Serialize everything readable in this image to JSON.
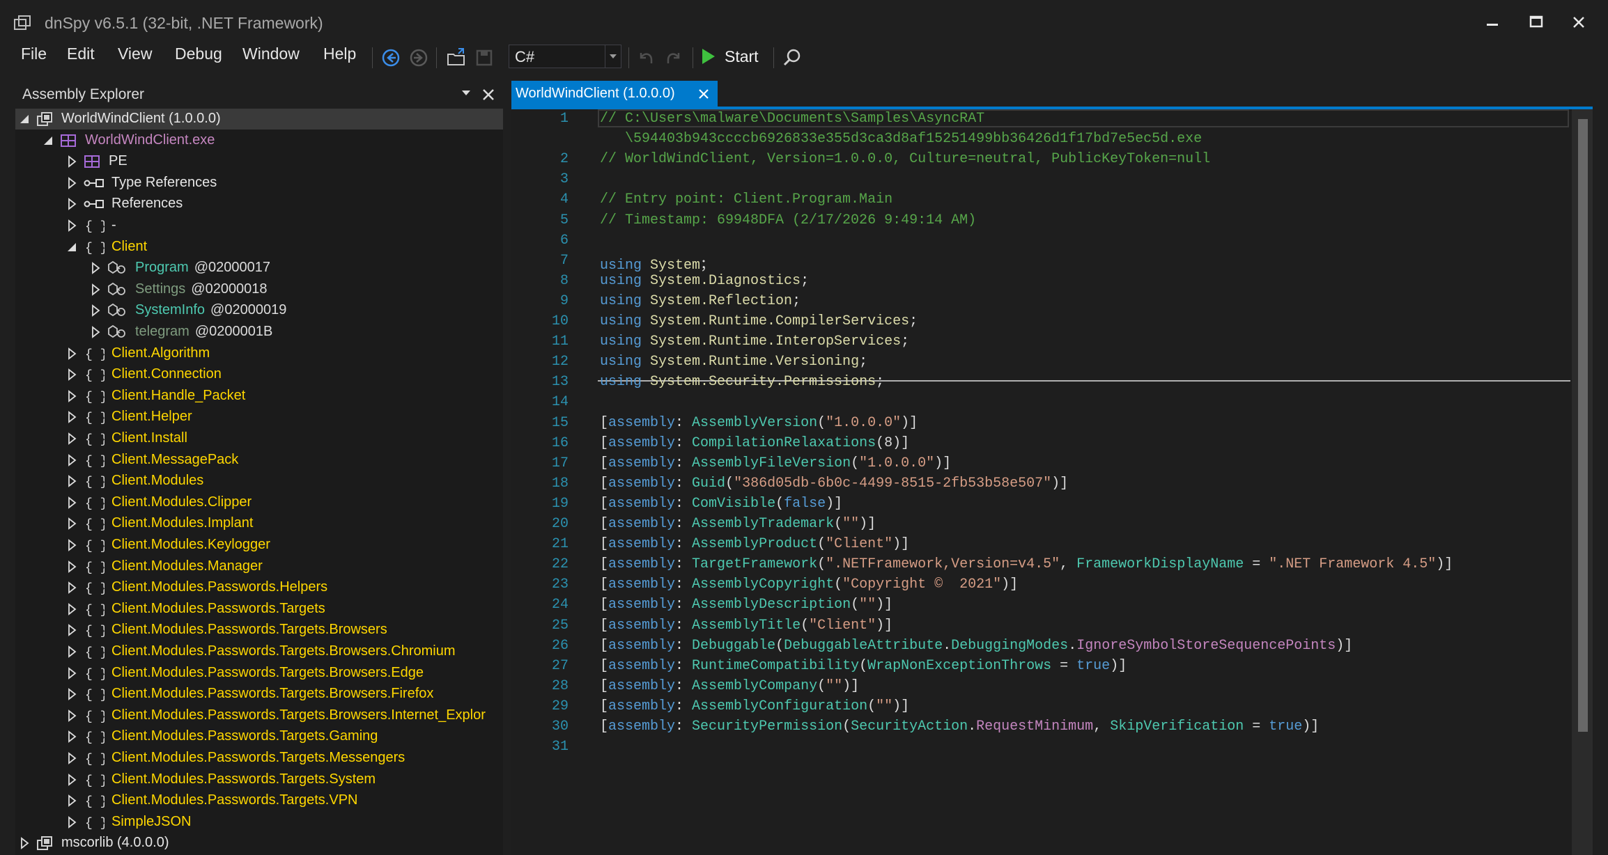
{
  "window": {
    "title": "dnSpy v6.5.1 (32-bit, .NET Framework)",
    "icons": [
      "app-icon",
      "minimize-icon",
      "maximize-icon",
      "close-icon"
    ]
  },
  "menu": [
    "File",
    "Edit",
    "View",
    "Debug",
    "Window",
    "Help"
  ],
  "toolbar": {
    "language": "C#",
    "start_label": "Start",
    "icons": [
      "back-icon",
      "forward-icon",
      "open-folder-icon",
      "save-icon",
      "undo-icon",
      "redo-icon",
      "start-icon",
      "search-icon"
    ]
  },
  "explorer": {
    "title": "Assembly Explorer",
    "items": [
      {
        "label": "WorldWindClient (1.0.0.0)",
        "suffix": "",
        "level": 0,
        "state": "expanded",
        "icon": "assembly-icon",
        "color": "#e6e6e6",
        "selected": true
      },
      {
        "label": "WorldWindClient.exe",
        "suffix": "",
        "level": 1,
        "state": "expanded",
        "icon": "module-icon",
        "color": "#c586c0"
      },
      {
        "label": "PE",
        "suffix": "",
        "level": 2,
        "state": "collapsed",
        "icon": "module-icon",
        "color": "#e6e6e6"
      },
      {
        "label": "Type References",
        "suffix": "",
        "level": 2,
        "state": "collapsed",
        "icon": "references-icon",
        "color": "#e6e6e6"
      },
      {
        "label": "References",
        "suffix": "",
        "level": 2,
        "state": "collapsed",
        "icon": "references-icon",
        "color": "#e6e6e6"
      },
      {
        "label": "-",
        "suffix": "",
        "level": 2,
        "state": "collapsed",
        "icon": "namespace-icon",
        "color": "#e6e6e6"
      },
      {
        "label": "Client",
        "suffix": "",
        "level": 2,
        "state": "expanded",
        "icon": "namespace-icon",
        "color": "#ffd700"
      },
      {
        "label": "Program",
        "suffix": "@02000017",
        "level": 3,
        "state": "collapsed",
        "icon": "class-icon",
        "color": "#4ec9b0"
      },
      {
        "label": "Settings",
        "suffix": "@02000018",
        "level": 3,
        "state": "collapsed",
        "icon": "class-icon",
        "color": "#7f9c7f"
      },
      {
        "label": "SystemInfo",
        "suffix": "@02000019",
        "level": 3,
        "state": "collapsed",
        "icon": "class-icon",
        "color": "#4ec9b0"
      },
      {
        "label": "telegram",
        "suffix": "@0200001B",
        "level": 3,
        "state": "collapsed",
        "icon": "class-icon",
        "color": "#7f9c7f"
      },
      {
        "label": "Client.Algorithm",
        "suffix": "",
        "level": 2,
        "state": "collapsed",
        "icon": "namespace-icon",
        "color": "#ffd700"
      },
      {
        "label": "Client.Connection",
        "suffix": "",
        "level": 2,
        "state": "collapsed",
        "icon": "namespace-icon",
        "color": "#ffd700"
      },
      {
        "label": "Client.Handle_Packet",
        "suffix": "",
        "level": 2,
        "state": "collapsed",
        "icon": "namespace-icon",
        "color": "#ffd700"
      },
      {
        "label": "Client.Helper",
        "suffix": "",
        "level": 2,
        "state": "collapsed",
        "icon": "namespace-icon",
        "color": "#ffd700"
      },
      {
        "label": "Client.Install",
        "suffix": "",
        "level": 2,
        "state": "collapsed",
        "icon": "namespace-icon",
        "color": "#ffd700"
      },
      {
        "label": "Client.MessagePack",
        "suffix": "",
        "level": 2,
        "state": "collapsed",
        "icon": "namespace-icon",
        "color": "#ffd700"
      },
      {
        "label": "Client.Modules",
        "suffix": "",
        "level": 2,
        "state": "collapsed",
        "icon": "namespace-icon",
        "color": "#ffd700"
      },
      {
        "label": "Client.Modules.Clipper",
        "suffix": "",
        "level": 2,
        "state": "collapsed",
        "icon": "namespace-icon",
        "color": "#ffd700"
      },
      {
        "label": "Client.Modules.Implant",
        "suffix": "",
        "level": 2,
        "state": "collapsed",
        "icon": "namespace-icon",
        "color": "#ffd700"
      },
      {
        "label": "Client.Modules.Keylogger",
        "suffix": "",
        "level": 2,
        "state": "collapsed",
        "icon": "namespace-icon",
        "color": "#ffd700"
      },
      {
        "label": "Client.Modules.Manager",
        "suffix": "",
        "level": 2,
        "state": "collapsed",
        "icon": "namespace-icon",
        "color": "#ffd700"
      },
      {
        "label": "Client.Modules.Passwords.Helpers",
        "suffix": "",
        "level": 2,
        "state": "collapsed",
        "icon": "namespace-icon",
        "color": "#ffd700"
      },
      {
        "label": "Client.Modules.Passwords.Targets",
        "suffix": "",
        "level": 2,
        "state": "collapsed",
        "icon": "namespace-icon",
        "color": "#ffd700"
      },
      {
        "label": "Client.Modules.Passwords.Targets.Browsers",
        "suffix": "",
        "level": 2,
        "state": "collapsed",
        "icon": "namespace-icon",
        "color": "#ffd700"
      },
      {
        "label": "Client.Modules.Passwords.Targets.Browsers.Chromium",
        "suffix": "",
        "level": 2,
        "state": "collapsed",
        "icon": "namespace-icon",
        "color": "#ffd700"
      },
      {
        "label": "Client.Modules.Passwords.Targets.Browsers.Edge",
        "suffix": "",
        "level": 2,
        "state": "collapsed",
        "icon": "namespace-icon",
        "color": "#ffd700"
      },
      {
        "label": "Client.Modules.Passwords.Targets.Browsers.Firefox",
        "suffix": "",
        "level": 2,
        "state": "collapsed",
        "icon": "namespace-icon",
        "color": "#ffd700"
      },
      {
        "label": "Client.Modules.Passwords.Targets.Browsers.Internet_Explor",
        "suffix": "",
        "level": 2,
        "state": "collapsed",
        "icon": "namespace-icon",
        "color": "#ffd700"
      },
      {
        "label": "Client.Modules.Passwords.Targets.Gaming",
        "suffix": "",
        "level": 2,
        "state": "collapsed",
        "icon": "namespace-icon",
        "color": "#ffd700"
      },
      {
        "label": "Client.Modules.Passwords.Targets.Messengers",
        "suffix": "",
        "level": 2,
        "state": "collapsed",
        "icon": "namespace-icon",
        "color": "#ffd700"
      },
      {
        "label": "Client.Modules.Passwords.Targets.System",
        "suffix": "",
        "level": 2,
        "state": "collapsed",
        "icon": "namespace-icon",
        "color": "#ffd700"
      },
      {
        "label": "Client.Modules.Passwords.Targets.VPN",
        "suffix": "",
        "level": 2,
        "state": "collapsed",
        "icon": "namespace-icon",
        "color": "#ffd700"
      },
      {
        "label": "SimpleJSON",
        "suffix": "",
        "level": 2,
        "state": "collapsed",
        "icon": "namespace-icon",
        "color": "#ffd700"
      },
      {
        "label": "mscorlib (4.0.0.0)",
        "suffix": "",
        "level": 0,
        "state": "collapsed",
        "icon": "assembly-icon",
        "color": "#e6e6e6"
      }
    ]
  },
  "tab": {
    "label": "WorldWindClient (1.0.0.0)"
  },
  "editor": {
    "lines": [
      {
        "n": "1",
        "t": [
          [
            "c-com",
            "// C:\\Users\\malware\\Documents\\Samples\\AsyncRAT"
          ]
        ]
      },
      {
        "n": "",
        "t": [
          [
            "c-com",
            "   \\594403b943ccccb6926833e355d3ca3d8af15251499bb36426d1f17bd7e5ec5d.exe"
          ]
        ]
      },
      {
        "n": "2",
        "t": [
          [
            "c-com",
            "// WorldWindClient, Version=1.0.0.0, Culture=neutral, PublicKeyToken=null"
          ]
        ]
      },
      {
        "n": "3",
        "t": []
      },
      {
        "n": "4",
        "t": [
          [
            "c-com",
            "// Entry point: Client.Program.Main"
          ]
        ]
      },
      {
        "n": "5",
        "t": [
          [
            "c-com",
            "// Timestamp: 69948DFA (2/17/2026 9:49:14 AM)"
          ]
        ]
      },
      {
        "n": "6",
        "t": []
      },
      {
        "n": "7",
        "t": [
          [
            "c-kw",
            "using "
          ],
          [
            "c-ns",
            "System"
          ],
          [
            "",
            "；"
          ]
        ]
      },
      {
        "n": "8",
        "t": [
          [
            "c-kw",
            "using "
          ],
          [
            "c-ns",
            "System.Diagnostics"
          ],
          [
            "",
            ";"
          ]
        ]
      },
      {
        "n": "9",
        "t": [
          [
            "c-kw",
            "using "
          ],
          [
            "c-ns",
            "System.Reflection"
          ],
          [
            "",
            ";"
          ]
        ]
      },
      {
        "n": "10",
        "t": [
          [
            "c-kw",
            "using "
          ],
          [
            "c-ns",
            "System.Runtime.CompilerServices"
          ],
          [
            "",
            ";"
          ]
        ]
      },
      {
        "n": "11",
        "t": [
          [
            "c-kw",
            "using "
          ],
          [
            "c-ns",
            "System.Runtime.InteropServices"
          ],
          [
            "",
            ";"
          ]
        ]
      },
      {
        "n": "12",
        "t": [
          [
            "c-kw",
            "using "
          ],
          [
            "c-ns",
            "System.Runtime.Versioning"
          ],
          [
            "",
            ";"
          ]
        ]
      },
      {
        "n": "13",
        "t": [
          [
            "c-kw",
            "using "
          ],
          [
            "c-ns",
            "System.Security.Permissions"
          ],
          [
            "",
            ";"
          ]
        ]
      },
      {
        "n": "14",
        "t": []
      },
      {
        "n": "15",
        "t": [
          [
            "",
            "["
          ],
          [
            "c-kw",
            "assembly"
          ],
          [
            "",
            ": "
          ],
          [
            "c-typ",
            "AssemblyVersion"
          ],
          [
            "",
            "("
          ],
          [
            "c-str",
            "\"1.0.0.0\""
          ],
          [
            "",
            ")]"
          ]
        ]
      },
      {
        "n": "16",
        "t": [
          [
            "",
            "["
          ],
          [
            "c-kw",
            "assembly"
          ],
          [
            "",
            ": "
          ],
          [
            "c-typ",
            "CompilationRelaxations"
          ],
          [
            "",
            "(8)]"
          ]
        ]
      },
      {
        "n": "17",
        "t": [
          [
            "",
            "["
          ],
          [
            "c-kw",
            "assembly"
          ],
          [
            "",
            ": "
          ],
          [
            "c-typ",
            "AssemblyFileVersion"
          ],
          [
            "",
            "("
          ],
          [
            "c-str",
            "\"1.0.0.0\""
          ],
          [
            "",
            ")]"
          ]
        ]
      },
      {
        "n": "18",
        "t": [
          [
            "",
            "["
          ],
          [
            "c-kw",
            "assembly"
          ],
          [
            "",
            ": "
          ],
          [
            "c-typ",
            "Guid"
          ],
          [
            "",
            "("
          ],
          [
            "c-str",
            "\"386d05db-6b0c-4499-8515-2fb53b58e507\""
          ],
          [
            "",
            ")]"
          ]
        ]
      },
      {
        "n": "19",
        "t": [
          [
            "",
            "["
          ],
          [
            "c-kw",
            "assembly"
          ],
          [
            "",
            ": "
          ],
          [
            "c-typ",
            "ComVisible"
          ],
          [
            "",
            "("
          ],
          [
            "c-kw",
            "false"
          ],
          [
            "",
            ")]"
          ]
        ]
      },
      {
        "n": "20",
        "t": [
          [
            "",
            "["
          ],
          [
            "c-kw",
            "assembly"
          ],
          [
            "",
            ": "
          ],
          [
            "c-typ",
            "AssemblyTrademark"
          ],
          [
            "",
            "("
          ],
          [
            "c-str",
            "\"\""
          ],
          [
            "",
            ")]"
          ]
        ]
      },
      {
        "n": "21",
        "t": [
          [
            "",
            "["
          ],
          [
            "c-kw",
            "assembly"
          ],
          [
            "",
            ": "
          ],
          [
            "c-typ",
            "AssemblyProduct"
          ],
          [
            "",
            "("
          ],
          [
            "c-str",
            "\"Client\""
          ],
          [
            "",
            ")]"
          ]
        ]
      },
      {
        "n": "22",
        "t": [
          [
            "",
            "["
          ],
          [
            "c-kw",
            "assembly"
          ],
          [
            "",
            ": "
          ],
          [
            "c-typ",
            "TargetFramework"
          ],
          [
            "",
            "("
          ],
          [
            "c-str",
            "\".NETFramework,Version=v4.5\""
          ],
          [
            "",
            ", "
          ],
          [
            "c-typ",
            "FrameworkDisplayName"
          ],
          [
            "",
            " = "
          ],
          [
            "c-str",
            "\".NET Framework 4.5\""
          ],
          [
            "",
            ")]"
          ]
        ]
      },
      {
        "n": "23",
        "t": [
          [
            "",
            "["
          ],
          [
            "c-kw",
            "assembly"
          ],
          [
            "",
            ": "
          ],
          [
            "c-typ",
            "AssemblyCopyright"
          ],
          [
            "",
            "("
          ],
          [
            "c-str",
            "\"Copyright ©  2021\""
          ],
          [
            "",
            ")]"
          ]
        ]
      },
      {
        "n": "24",
        "t": [
          [
            "",
            "["
          ],
          [
            "c-kw",
            "assembly"
          ],
          [
            "",
            ": "
          ],
          [
            "c-typ",
            "AssemblyDescription"
          ],
          [
            "",
            "("
          ],
          [
            "c-str",
            "\"\""
          ],
          [
            "",
            ")]"
          ]
        ]
      },
      {
        "n": "25",
        "t": [
          [
            "",
            "["
          ],
          [
            "c-kw",
            "assembly"
          ],
          [
            "",
            ": "
          ],
          [
            "c-typ",
            "AssemblyTitle"
          ],
          [
            "",
            "("
          ],
          [
            "c-str",
            "\"Client\""
          ],
          [
            "",
            ")]"
          ]
        ]
      },
      {
        "n": "26",
        "t": [
          [
            "",
            "["
          ],
          [
            "c-kw",
            "assembly"
          ],
          [
            "",
            ": "
          ],
          [
            "c-typ",
            "Debuggable"
          ],
          [
            "",
            "("
          ],
          [
            "c-typ",
            "DebuggableAttribute"
          ],
          [
            "",
            "."
          ],
          [
            "c-typ",
            "DebuggingModes"
          ],
          [
            "",
            "."
          ],
          [
            "c-prop",
            "IgnoreSymbolStoreSequencePoints"
          ],
          [
            "",
            ")]"
          ]
        ]
      },
      {
        "n": "27",
        "t": [
          [
            "",
            "["
          ],
          [
            "c-kw",
            "assembly"
          ],
          [
            "",
            ": "
          ],
          [
            "c-typ",
            "RuntimeCompatibility"
          ],
          [
            "",
            "("
          ],
          [
            "c-typ",
            "WrapNonExceptionThrows"
          ],
          [
            "",
            " = "
          ],
          [
            "c-kw",
            "true"
          ],
          [
            "",
            ")]"
          ]
        ]
      },
      {
        "n": "28",
        "t": [
          [
            "",
            "["
          ],
          [
            "c-kw",
            "assembly"
          ],
          [
            "",
            ": "
          ],
          [
            "c-typ",
            "AssemblyCompany"
          ],
          [
            "",
            "("
          ],
          [
            "c-str",
            "\"\""
          ],
          [
            "",
            ")]"
          ]
        ]
      },
      {
        "n": "29",
        "t": [
          [
            "",
            "["
          ],
          [
            "c-kw",
            "assembly"
          ],
          [
            "",
            ": "
          ],
          [
            "c-typ",
            "AssemblyConfiguration"
          ],
          [
            "",
            "("
          ],
          [
            "c-str",
            "\"\""
          ],
          [
            "",
            ")]"
          ]
        ]
      },
      {
        "n": "30",
        "t": [
          [
            "",
            "["
          ],
          [
            "c-kw",
            "assembly"
          ],
          [
            "",
            ": "
          ],
          [
            "c-typ",
            "SecurityPermission"
          ],
          [
            "",
            "("
          ],
          [
            "c-typ",
            "SecurityAction"
          ],
          [
            "",
            "."
          ],
          [
            "c-prop",
            "RequestMinimum"
          ],
          [
            "",
            ", "
          ],
          [
            "c-typ",
            "SkipVerification"
          ],
          [
            "",
            " = "
          ],
          [
            "c-kw",
            "true"
          ],
          [
            "",
            ")]"
          ]
        ]
      },
      {
        "n": "31",
        "t": []
      }
    ]
  }
}
